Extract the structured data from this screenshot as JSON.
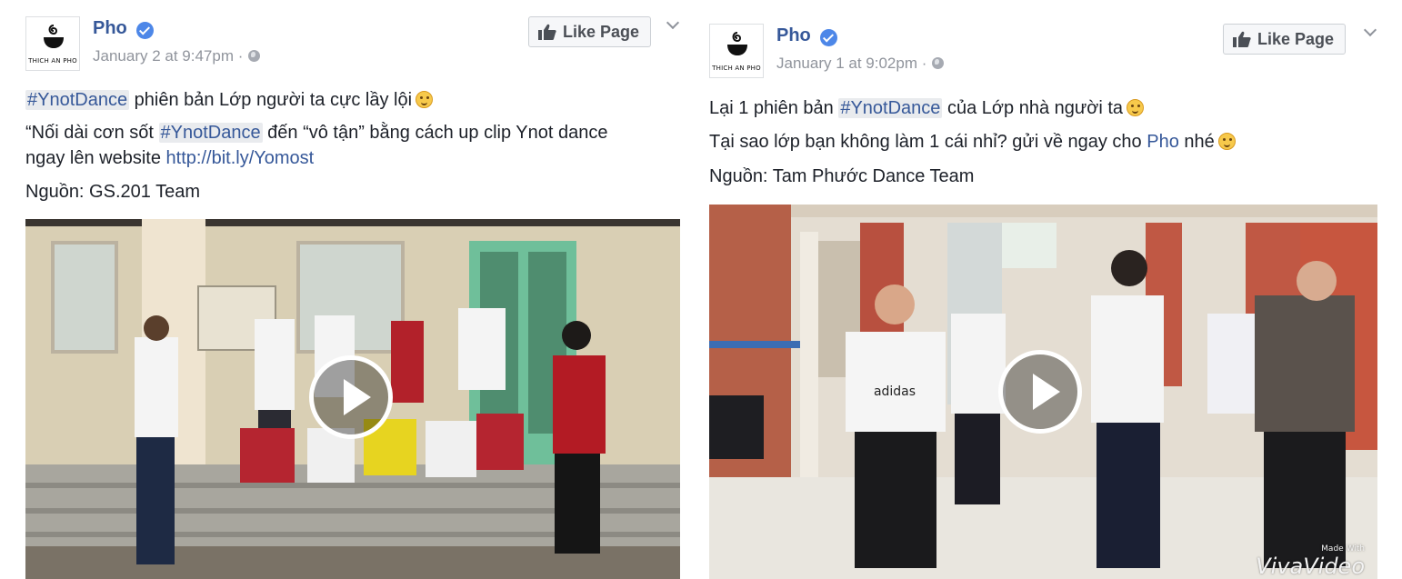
{
  "posts": [
    {
      "page_name": "Pho",
      "avatar_text": "THICH AN PHO",
      "timestamp": "January 2 at 9:47pm",
      "like_button": "Like Page",
      "line1": {
        "hashtag": "#YnotDance",
        "text": " phiên bản Lớp người ta cực lầy lội"
      },
      "line2": {
        "prefix": "“Nối dài cơn sốt ",
        "hashtag": "#YnotDance",
        "suffix": " đến “vô tận” bằng cách up clip Ynot dance"
      },
      "line3": {
        "prefix": "ngay lên website ",
        "link": "http://bit.ly/Yomost"
      },
      "line4": "Nguồn: GS.201 Team",
      "video_icon": "play-icon"
    },
    {
      "page_name": "Pho",
      "avatar_text": "THICH AN PHO",
      "timestamp": "January 1 at 9:02pm",
      "like_button": "Like Page",
      "line1": {
        "prefix": "Lại 1 phiên bản ",
        "hashtag": "#YnotDance",
        "suffix": " của Lớp nhà người ta"
      },
      "line2": {
        "prefix": "Tại sao lớp bạn không làm 1 cái nhỉ? gửi về ngay cho ",
        "link": "Pho",
        "suffix": " nhé"
      },
      "line3": "Nguồn: Tam Phước Dance Team",
      "shirt_text": "adidas",
      "watermark_small": "Made With",
      "watermark_big": "VivaVideo",
      "video_icon": "play-icon"
    }
  ],
  "colors": {
    "link": "#365899",
    "meta": "#90949c",
    "text": "#1d2129",
    "verified": "#4d87e8"
  }
}
